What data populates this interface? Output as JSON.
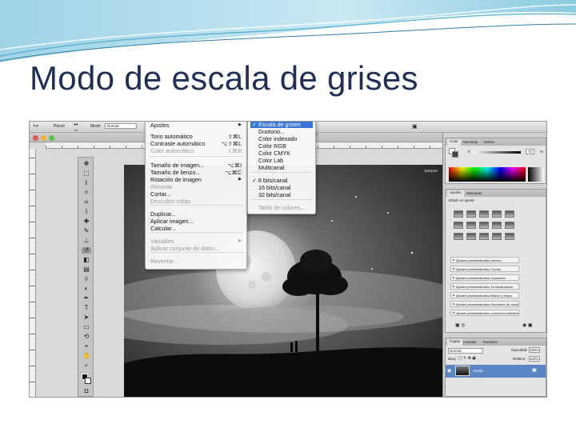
{
  "slide": {
    "title": "Modo de escala de grises"
  },
  "photoshop": {
    "options_bar": {
      "brush_label": "Pincel",
      "brush_size": "21",
      "mode_label": "Modo",
      "mode_value": "Normal"
    },
    "document_tab": "(8)*",
    "canvas_watermark": "panpax",
    "image_menu": {
      "items": [
        {
          "label": "Ajustes",
          "shortcut": "",
          "submenu": true,
          "disabled": false
        },
        {
          "label": "Tono automático",
          "shortcut": "⇧⌘L",
          "submenu": false,
          "disabled": false
        },
        {
          "label": "Contraste automático",
          "shortcut": "⌥⇧⌘L",
          "submenu": false,
          "disabled": false
        },
        {
          "label": "Color automático",
          "shortcut": "⇧⌘B",
          "submenu": false,
          "disabled": true
        },
        {
          "label": "Tamaño de imagen...",
          "shortcut": "⌥⌘I",
          "submenu": false,
          "disabled": false
        },
        {
          "label": "Tamaño de lienzo...",
          "shortcut": "⌥⌘C",
          "submenu": false,
          "disabled": false
        },
        {
          "label": "Rotación de imagen",
          "shortcut": "",
          "submenu": true,
          "disabled": false
        },
        {
          "label": "Recortar",
          "shortcut": "",
          "submenu": false,
          "disabled": true
        },
        {
          "label": "Cortar...",
          "shortcut": "",
          "submenu": false,
          "disabled": false
        },
        {
          "label": "Descubrir todas",
          "shortcut": "",
          "submenu": false,
          "disabled": true
        },
        {
          "label": "Duplicar...",
          "shortcut": "",
          "submenu": false,
          "disabled": false
        },
        {
          "label": "Aplicar imagen...",
          "shortcut": "",
          "submenu": false,
          "disabled": false
        },
        {
          "label": "Calcular...",
          "shortcut": "",
          "submenu": false,
          "disabled": false
        },
        {
          "label": "Variables",
          "shortcut": "",
          "submenu": true,
          "disabled": true
        },
        {
          "label": "Aplicar conjunto de datos...",
          "shortcut": "",
          "submenu": false,
          "disabled": true
        },
        {
          "label": "Reventar...",
          "shortcut": "",
          "submenu": false,
          "disabled": true
        }
      ]
    },
    "mode_submenu": {
      "items": [
        {
          "label": "Escala de grises",
          "checked": true,
          "selected": true,
          "disabled": false
        },
        {
          "label": "Duotono...",
          "checked": false,
          "selected": false,
          "disabled": false
        },
        {
          "label": "Color indexado",
          "checked": false,
          "selected": false,
          "disabled": false
        },
        {
          "label": "Color RGB",
          "checked": false,
          "selected": false,
          "disabled": false
        },
        {
          "label": "Color CMYK",
          "checked": false,
          "selected": false,
          "disabled": false
        },
        {
          "label": "Color Lab",
          "checked": false,
          "selected": false,
          "disabled": false
        },
        {
          "label": "Multicanal",
          "checked": false,
          "selected": false,
          "disabled": false
        },
        {
          "label": "8 bits/canal",
          "checked": true,
          "selected": false,
          "disabled": false
        },
        {
          "label": "16 bits/canal",
          "checked": false,
          "selected": false,
          "disabled": false
        },
        {
          "label": "32 bits/canal",
          "checked": false,
          "selected": false,
          "disabled": false
        },
        {
          "label": "Tabla de colores...",
          "checked": false,
          "selected": false,
          "disabled": true
        }
      ]
    },
    "color_panel": {
      "tabs": [
        "Color",
        "Muestras",
        "Estilos"
      ],
      "k_label": "K",
      "k_value": "74",
      "k_unit": "%"
    },
    "adjustments_panel": {
      "tabs": [
        "Ajustes",
        "Máscaras"
      ],
      "heading": "Añadir un ajuste",
      "presets": [
        "Ajustes preestablecidos Niveles",
        "Ajustes preestablecidos Curvas",
        "Ajustes preestablecidos exposición",
        "Ajustes preestablecidos Tono/saturación",
        "Ajustes preestablecidos Blanco y negro",
        "Ajustes preestablecidos Mezclador de canales",
        "Ajustes preestablecidos corrección selectiva"
      ]
    },
    "layers_panel": {
      "tabs": [
        "Capas",
        "Canales",
        "Trazados"
      ],
      "blend_mode": "Normal",
      "opacity_label": "Opacidad:",
      "opacity_value": "100%",
      "lock_label": "Bloq:",
      "fill_label": "Relleno:",
      "fill_value": "100%",
      "layer_name": "Fondo"
    },
    "colors": {
      "menu_highlight": "#3875d7",
      "title_color": "#1f2f58"
    }
  }
}
